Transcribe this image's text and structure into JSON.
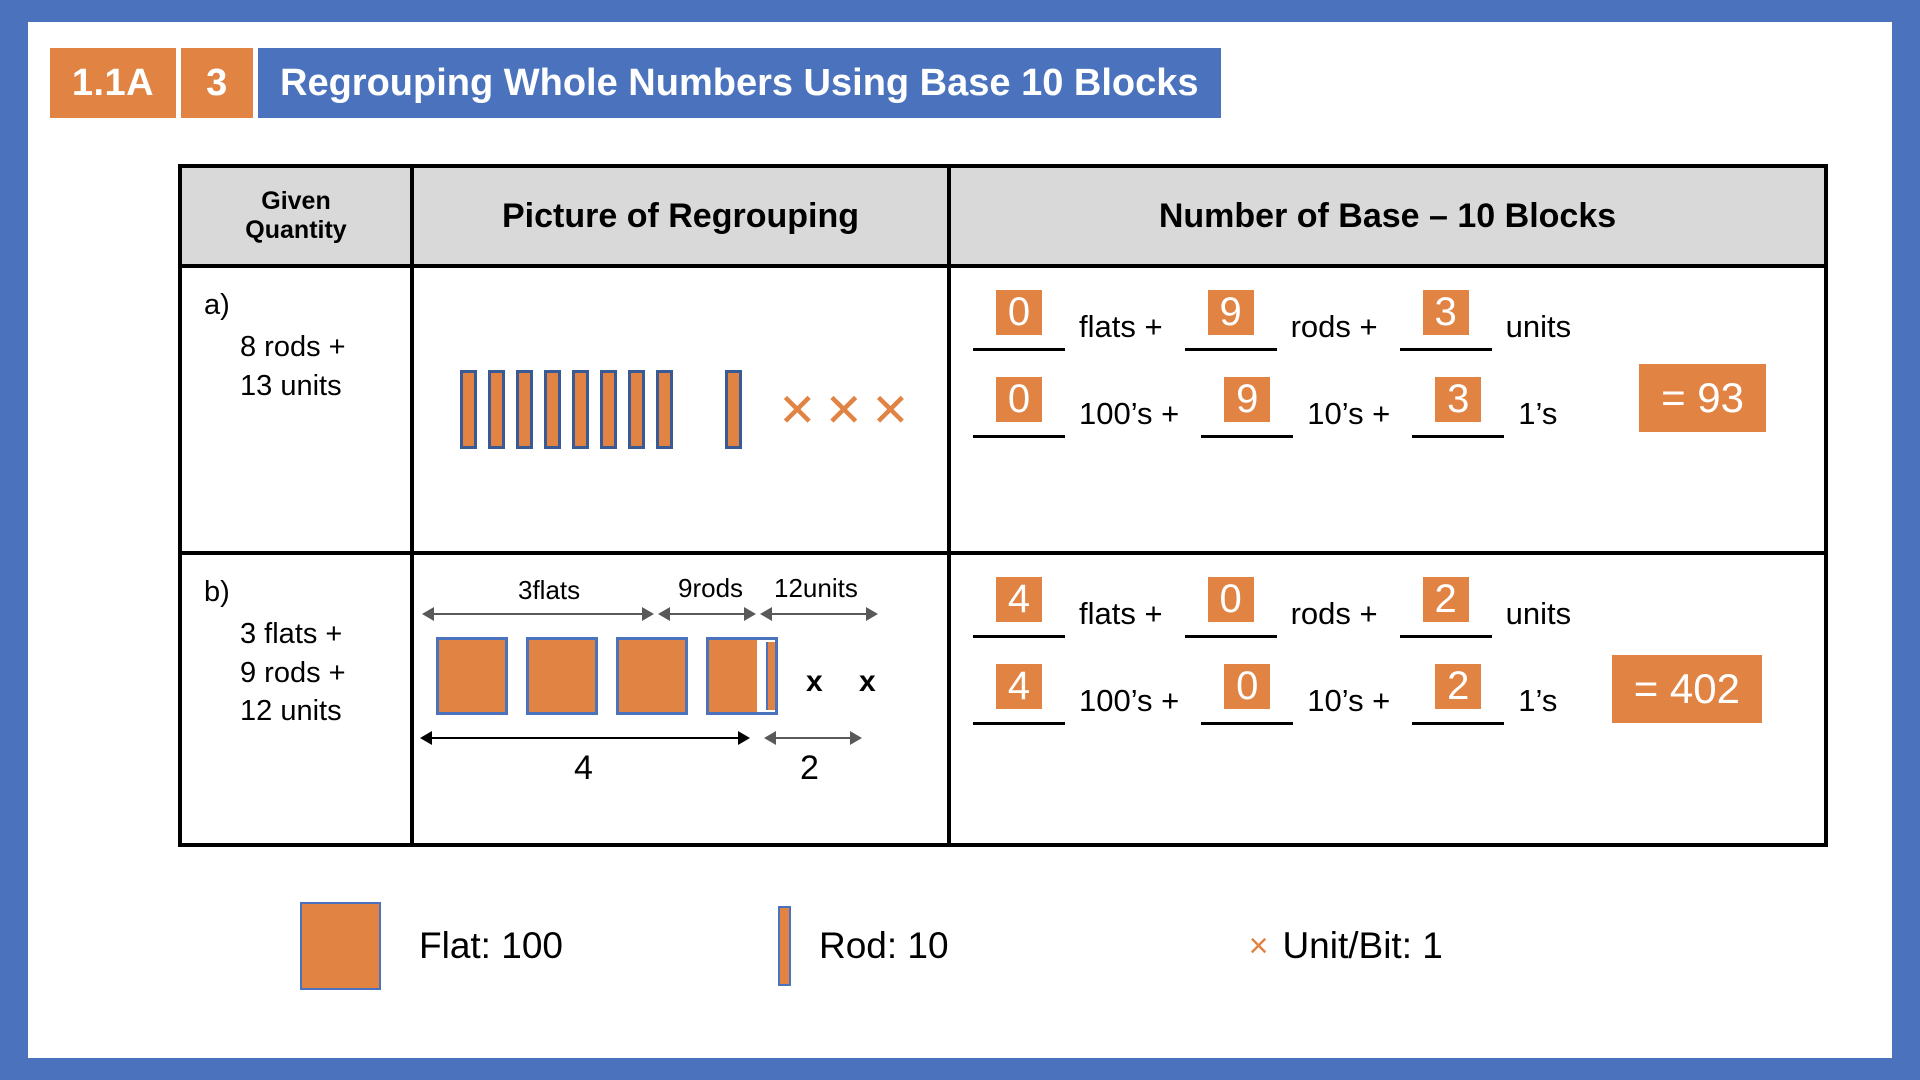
{
  "header": {
    "badge_code": "1.1A",
    "badge_number": "3",
    "title": "Regrouping Whole Numbers Using Base 10 Blocks",
    "colors": {
      "orange": "#E08343",
      "blue": "#4A72BD"
    }
  },
  "table": {
    "headers": {
      "given_line1": "Given",
      "given_line2": "Quantity",
      "picture": "Picture of Regrouping",
      "number": "Number of Base – 10 Blocks"
    },
    "rows": [
      {
        "label": "a)",
        "given": [
          "8 rods +",
          "13 units"
        ],
        "picture": {
          "rod_group_count": 8,
          "single_rod_count": 1,
          "unit_x_count": 3
        },
        "number_line1": {
          "values": [
            "0",
            "9",
            "3"
          ],
          "labels": [
            "flats +",
            "rods +",
            "units"
          ]
        },
        "number_line2": {
          "values": [
            "0",
            "9",
            "3"
          ],
          "labels": [
            "100’s +",
            "10’s +",
            "1’s"
          ]
        },
        "result": "= 93"
      },
      {
        "label": "b)",
        "given": [
          "3 flats +",
          "9 rods +",
          "12 units"
        ],
        "picture": {
          "top_arrows": [
            {
              "label": "3flats"
            },
            {
              "label": "9rods"
            },
            {
              "label": "12units"
            }
          ],
          "bottom_arrows": [
            {
              "label": "4"
            },
            {
              "label": "2"
            }
          ],
          "full_flats": 3,
          "partial_flat": 1,
          "unit_marks": "x  x"
        },
        "number_line1": {
          "values": [
            "4",
            "0",
            "2"
          ],
          "labels": [
            "flats +",
            "rods +",
            "units"
          ]
        },
        "number_line2": {
          "values": [
            "4",
            "0",
            "2"
          ],
          "labels": [
            "100’s +",
            "10’s +",
            "1’s"
          ]
        },
        "result": "= 402"
      }
    ]
  },
  "legend": {
    "flat": "Flat: 100",
    "rod": "Rod: 10",
    "unit_symbol": "×",
    "unit": "Unit/Bit: 1"
  }
}
